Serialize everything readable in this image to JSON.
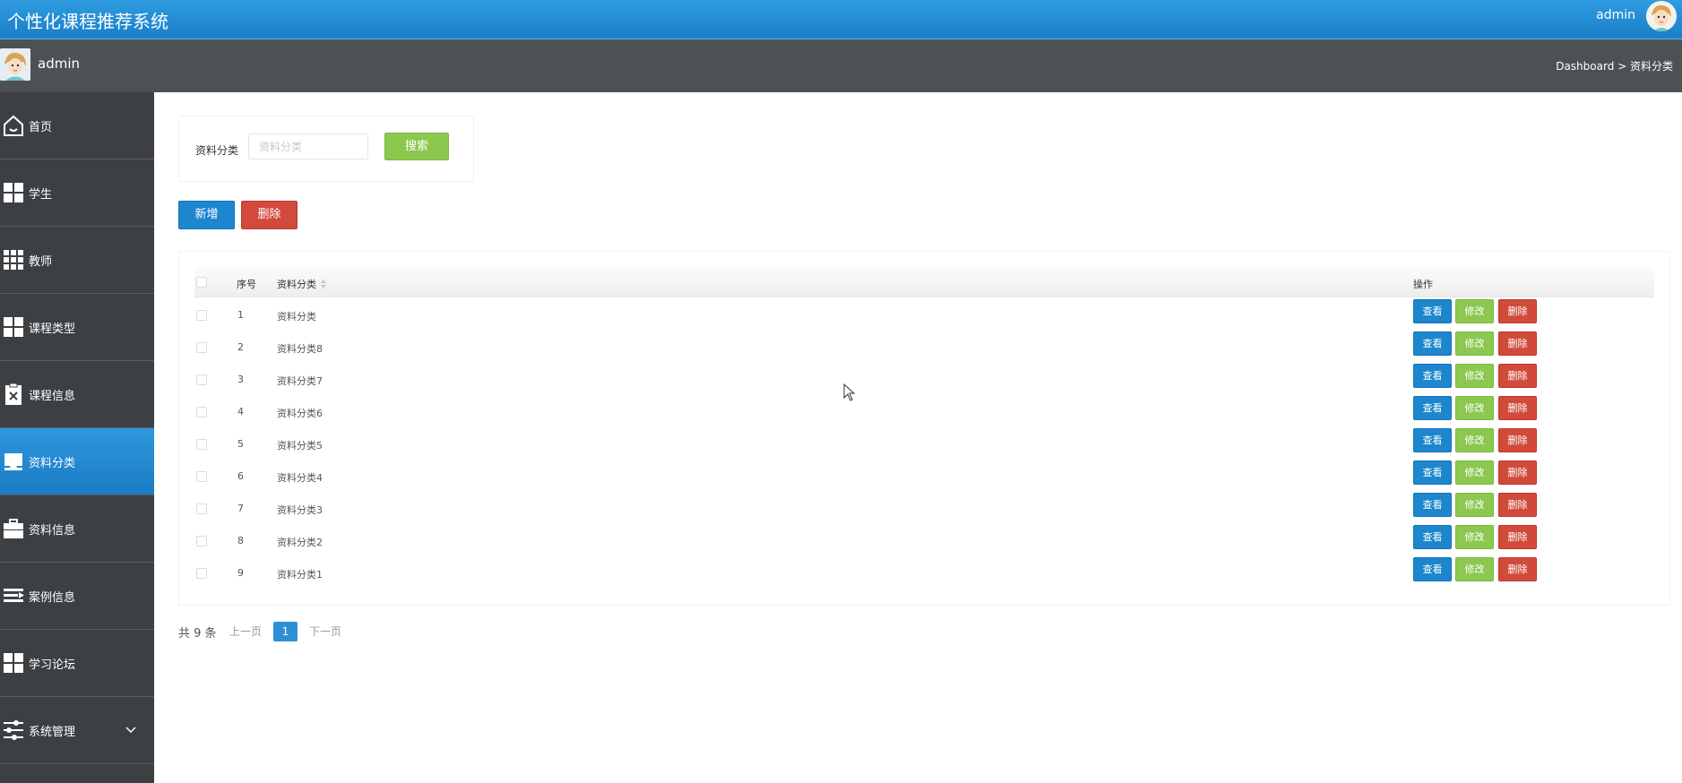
{
  "app": {
    "title": "个性化课程推荐系统",
    "user": "admin"
  },
  "subbar": {
    "user": "admin",
    "breadcrumb": "Dashboard > 资料分类"
  },
  "sidebar": {
    "items": [
      {
        "label": "首页",
        "icon": "home-icon",
        "active": false
      },
      {
        "label": "学生",
        "icon": "grid-icon",
        "active": false
      },
      {
        "label": "教师",
        "icon": "apps-icon",
        "active": false
      },
      {
        "label": "课程类型",
        "icon": "grid-icon",
        "active": false
      },
      {
        "label": "课程信息",
        "icon": "clipboard-icon",
        "active": false
      },
      {
        "label": "资料分类",
        "icon": "tray-icon",
        "active": true
      },
      {
        "label": "资料信息",
        "icon": "briefcase-icon",
        "active": false
      },
      {
        "label": "案例信息",
        "icon": "list-icon",
        "active": false
      },
      {
        "label": "学习论坛",
        "icon": "grid-icon",
        "active": false
      },
      {
        "label": "系统管理",
        "icon": "sliders-icon",
        "active": false
      }
    ]
  },
  "search": {
    "label": "资料分类",
    "placeholder": "资料分类",
    "button": "搜索"
  },
  "actions": {
    "add": "新增",
    "delete": "删除"
  },
  "table": {
    "columns": {
      "index": "序号",
      "category": "资料分类",
      "ops": "操作"
    },
    "op_labels": {
      "view": "查看",
      "edit": "修改",
      "delete": "删除"
    },
    "rows": [
      {
        "index": "1",
        "category": "资料分类"
      },
      {
        "index": "2",
        "category": "资料分类8"
      },
      {
        "index": "3",
        "category": "资料分类7"
      },
      {
        "index": "4",
        "category": "资料分类6"
      },
      {
        "index": "5",
        "category": "资料分类5"
      },
      {
        "index": "6",
        "category": "资料分类4"
      },
      {
        "index": "7",
        "category": "资料分类3"
      },
      {
        "index": "8",
        "category": "资料分类2"
      },
      {
        "index": "9",
        "category": "资料分类1"
      }
    ]
  },
  "pager": {
    "total": "共 9 条",
    "prev": "上一页",
    "current": "1",
    "next": "下一页"
  },
  "colors": {
    "primary": "#1d86cf",
    "success": "#8cc850",
    "danger": "#d24a3c",
    "sidebar": "#3d4043",
    "topbar": "#2f9be0"
  }
}
